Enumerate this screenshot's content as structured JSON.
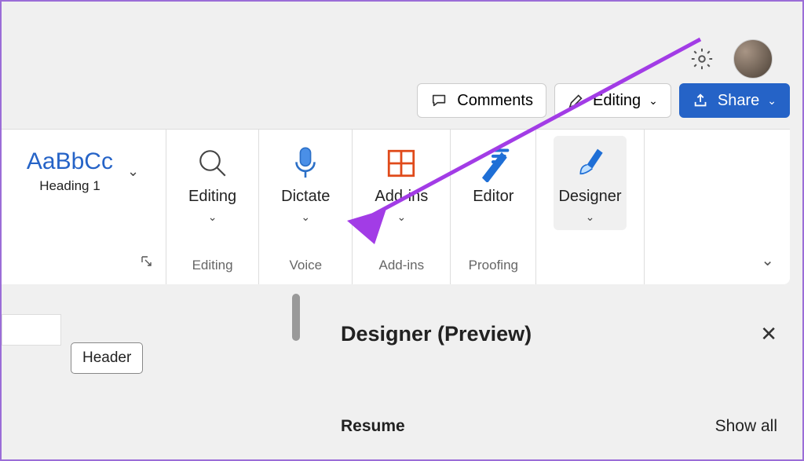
{
  "topBar": {
    "comments_label": "Comments",
    "editing_label": "Editing",
    "share_label": "Share"
  },
  "ribbon": {
    "style": {
      "preview": "AaBbCc",
      "name": "Heading 1"
    },
    "sections": {
      "editing": {
        "button": "Editing",
        "group": "Editing"
      },
      "voice": {
        "button": "Dictate",
        "group": "Voice"
      },
      "addins": {
        "button": "Add-ins",
        "group": "Add-ins"
      },
      "proofing": {
        "button": "Editor",
        "group": "Proofing"
      },
      "designer": {
        "button": "Designer"
      }
    }
  },
  "document": {
    "headerTag": "Header"
  },
  "panel": {
    "title": "Designer (Preview)",
    "section": "Resume",
    "showAll": "Show all"
  }
}
